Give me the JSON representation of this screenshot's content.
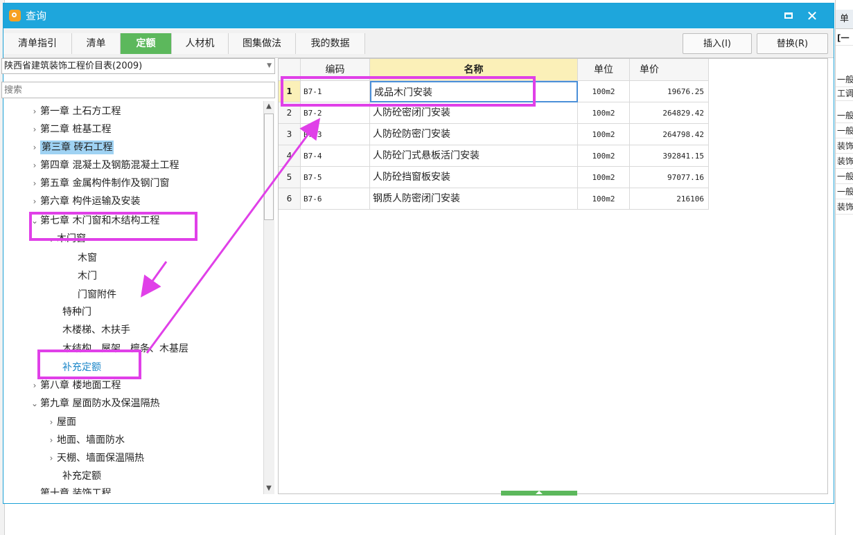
{
  "window": {
    "title": "查询",
    "maximize_icon": "maximize-icon",
    "close_label": "✕"
  },
  "tabs": [
    {
      "label": "清单指引",
      "active": false
    },
    {
      "label": "清单",
      "active": false
    },
    {
      "label": "定额",
      "active": true
    },
    {
      "label": "人材机",
      "active": false
    },
    {
      "label": "图集做法",
      "active": false
    },
    {
      "label": "我的数据",
      "active": false
    }
  ],
  "toolbar": {
    "insert_label": "插入(I)",
    "replace_label": "替换(R)"
  },
  "library": {
    "selected": "陕西省建筑装饰工程价目表(2009)"
  },
  "search": {
    "placeholder": "搜索"
  },
  "tree": [
    {
      "label": "第一章 土石方工程",
      "arrow": "›"
    },
    {
      "label": "第二章 桩基工程",
      "arrow": "›"
    },
    {
      "label": "第三章 砖石工程",
      "arrow": "›"
    },
    {
      "label": "第四章 混凝土及钢筋混凝土工程",
      "arrow": "›"
    },
    {
      "label": "第五章 金属构件制作及钢门窗",
      "arrow": "›"
    },
    {
      "label": "第六章 构件运输及安装",
      "arrow": "›"
    },
    {
      "label": "第七章 木门窗和木结构工程",
      "arrow": "⌄"
    },
    {
      "label": "木门窗",
      "arrow": "⌄"
    },
    {
      "label": "木窗",
      "arrow": ""
    },
    {
      "label": "木门",
      "arrow": ""
    },
    {
      "label": "门窗附件",
      "arrow": ""
    },
    {
      "label": "特种门",
      "arrow": ""
    },
    {
      "label": "木楼梯、木扶手",
      "arrow": ""
    },
    {
      "label": "木结构、屋架、檩条、木基层",
      "arrow": ""
    },
    {
      "label": "补充定额",
      "arrow": ""
    },
    {
      "label": "第八章 楼地面工程",
      "arrow": "›"
    },
    {
      "label": "第九章 屋面防水及保温隔热",
      "arrow": "⌄"
    },
    {
      "label": "屋面",
      "arrow": "›"
    },
    {
      "label": "地面、墙面防水",
      "arrow": "›"
    },
    {
      "label": "天棚、墙面保温隔热",
      "arrow": "›"
    },
    {
      "label": "补充定额",
      "arrow": ""
    },
    {
      "label": "第十章 装饰工程",
      "arrow": "⌄"
    }
  ],
  "grid": {
    "columns": [
      "编码",
      "名称",
      "单位",
      "单价"
    ],
    "rows": [
      {
        "num": "1",
        "code": "B7-1",
        "name": "成品木门安装",
        "unit": "100m2",
        "price": "19676.25"
      },
      {
        "num": "2",
        "code": "B7-2",
        "name": "人防砼密闭门安装",
        "unit": "100m2",
        "price": "264829.42"
      },
      {
        "num": "3",
        "code": "B7-3",
        "name": "人防砼防密门安装",
        "unit": "100m2",
        "price": "264798.42"
      },
      {
        "num": "4",
        "code": "B7-4",
        "name": "人防砼门式悬板活门安装",
        "unit": "100m2",
        "price": "392841.15"
      },
      {
        "num": "5",
        "code": "B7-5",
        "name": "人防砼挡窗板安装",
        "unit": "100m2",
        "price": "97077.16"
      },
      {
        "num": "6",
        "code": "B7-6",
        "name": "钢质人防密闭门安装",
        "unit": "100m2",
        "price": "216106"
      }
    ]
  },
  "background": {
    "right_header": "单",
    "right_sub": "[一",
    "right_cells": [
      "一般",
      "工调",
      "一般",
      "一般",
      "装饰",
      "装饰",
      "一般",
      "一般",
      "装饰"
    ]
  },
  "colors": {
    "titlebar": "#1ea6dc",
    "active_tab": "#5cb85c",
    "highlight": "#e040e8",
    "tree_selection": "#9fd2f3"
  }
}
